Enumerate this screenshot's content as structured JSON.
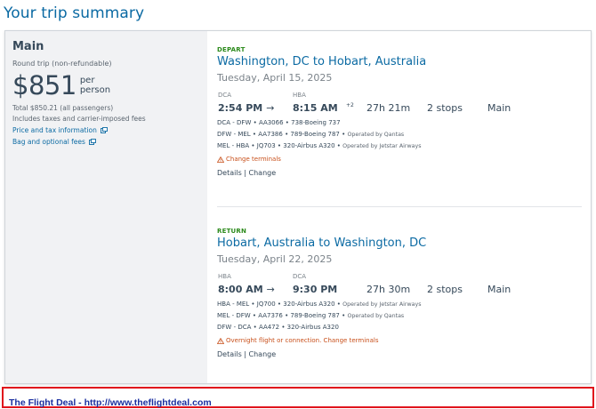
{
  "page": {
    "title": "Your trip summary"
  },
  "fare": {
    "name": "Main",
    "trip_type": "Round trip (non-refundable)",
    "price": "$851",
    "per_line1": "per",
    "per_line2": "person",
    "total": "Total $850.21 (all passengers)",
    "taxes_note": "Includes taxes and carrier-imposed fees",
    "price_tax_link": "Price and tax information",
    "bag_fees_link": "Bag and optional fees"
  },
  "depart": {
    "label": "DEPART",
    "route": "Washington, DC to Hobart, Australia",
    "date": "Tuesday, April 15, 2025",
    "origin_code": "DCA",
    "dest_code": "HBA",
    "depart_time": "2:54 PM",
    "arrive_time": "8:15 AM",
    "plus_days": "+2",
    "duration": "27h 21m",
    "stops": "2 stops",
    "cabin": "Main",
    "legs": [
      {
        "text": "DCA - DFW • AA3066 • 738-Boeing 737",
        "operated": ""
      },
      {
        "text": "DFW - MEL • AA7386 • 789-Boeing 787 •",
        "operated": "Operated by Qantas"
      },
      {
        "text": "MEL - HBA • JQ703 • 320-Airbus A320 •",
        "operated": "Operated by Jetstar Airways"
      }
    ],
    "warning": "Change terminals",
    "details": "Details | Change"
  },
  "return": {
    "label": "RETURN",
    "route": "Hobart, Australia to Washington, DC",
    "date": "Tuesday, April 22, 2025",
    "origin_code": "HBA",
    "dest_code": "DCA",
    "depart_time": "8:00 AM",
    "arrive_time": "9:30 PM",
    "duration": "27h 30m",
    "stops": "2 stops",
    "cabin": "Main",
    "legs": [
      {
        "text": "HBA - MEL • JQ700 • 320-Airbus A320 •",
        "operated": "Operated by Jetstar Airways"
      },
      {
        "text": "MEL - DFW • AA7376 • 789-Boeing 787 •",
        "operated": "Operated by Qantas"
      },
      {
        "text": "DFW - DCA • AA472 • 320-Airbus A320",
        "operated": ""
      }
    ],
    "warning": "Overnight flight or connection. Change terminals",
    "details": "Details | Change"
  },
  "footer": {
    "text": "The Flight Deal - http://www.theflightdeal.com"
  },
  "colors": {
    "brand_blue": "#0b6aa3",
    "depart_green": "#2c8a1c",
    "warning_orange": "#c8501b",
    "banner_border": "#e0141c",
    "banner_text": "#1a2fa0"
  },
  "icons": {
    "external_link": "external-link-icon",
    "warning": "warning-triangle-icon",
    "arrow": "arrow-right-icon"
  }
}
